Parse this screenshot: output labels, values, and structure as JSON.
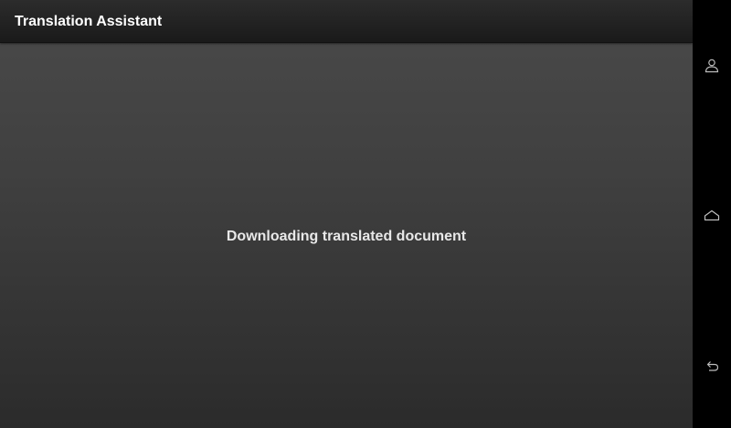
{
  "app_bar": {
    "title": "Translation Assistant"
  },
  "content": {
    "status_message": "Downloading translated document"
  },
  "nav_bar": {
    "buttons": [
      {
        "name": "account",
        "icon": "person-icon"
      },
      {
        "name": "home",
        "icon": "home-icon"
      },
      {
        "name": "back",
        "icon": "back-icon"
      }
    ]
  },
  "colors": {
    "app_bar_bg": "#1f1f1f",
    "content_bg": "#3c3c3c",
    "text": "#ffffff",
    "nav_bar_bg": "#000000",
    "nav_icon": "#bdbdbd"
  }
}
